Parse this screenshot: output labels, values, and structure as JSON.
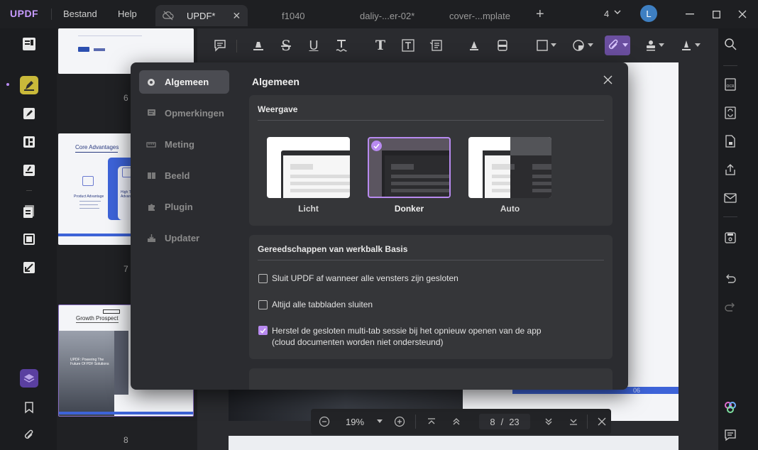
{
  "app": {
    "logo": "UPDF",
    "profile_initial": "L",
    "window_count": "4"
  },
  "menu": {
    "file": "Bestand",
    "help": "Help"
  },
  "tabs": [
    {
      "label": "UPDF*",
      "active": true
    },
    {
      "label": "f1040",
      "active": false
    },
    {
      "label": "daliy-...er-02*",
      "active": false
    },
    {
      "label": "cover-...mplate",
      "active": false
    }
  ],
  "thumbnails": {
    "page6": {
      "number": "6"
    },
    "page7": {
      "number": "7",
      "title": "Core Advantages",
      "sub1": "Product Advantage",
      "sub2": "High Team Advantage"
    },
    "page8": {
      "number": "8",
      "title": "Growth Prospect",
      "text": "UPDF: Powering The Future Of PDF Solutions"
    }
  },
  "document": {
    "page_number_mark": "06"
  },
  "settings": {
    "title": "Algemeen",
    "nav": [
      {
        "label": "Algemeen",
        "icon": "general-icon"
      },
      {
        "label": "Opmerkingen",
        "icon": "comment-icon"
      },
      {
        "label": "Meting",
        "icon": "ruler-icon"
      },
      {
        "label": "Beeld",
        "icon": "view-icon"
      },
      {
        "label": "Plugin",
        "icon": "puzzle-icon"
      },
      {
        "label": "Updater",
        "icon": "download-icon"
      }
    ],
    "appearance": {
      "title": "Weergave",
      "options": [
        {
          "label": "Licht",
          "selected": false
        },
        {
          "label": "Donker",
          "selected": true
        },
        {
          "label": "Auto",
          "selected": false
        }
      ]
    },
    "toolbar_tools": {
      "title": "Gereedschappen van werkbalk Basis",
      "options": [
        {
          "label": "Sluit UPDF af wanneer alle vensters zijn gesloten",
          "checked": false
        },
        {
          "label": "Altijd alle tabbladen sluiten",
          "checked": false
        },
        {
          "label": "Herstel de gesloten multi-tab sessie bij het opnieuw openen van de app",
          "label2": "(cloud documenten worden niet ondersteund)",
          "checked": true
        }
      ]
    }
  },
  "pagebar": {
    "zoom": "19%",
    "current_page": "8",
    "separator": "/",
    "total_pages": "23"
  },
  "colors": {
    "accent": "#b88af0",
    "logo": "#c79bff",
    "highlight_tool": "#6b4fa0"
  }
}
